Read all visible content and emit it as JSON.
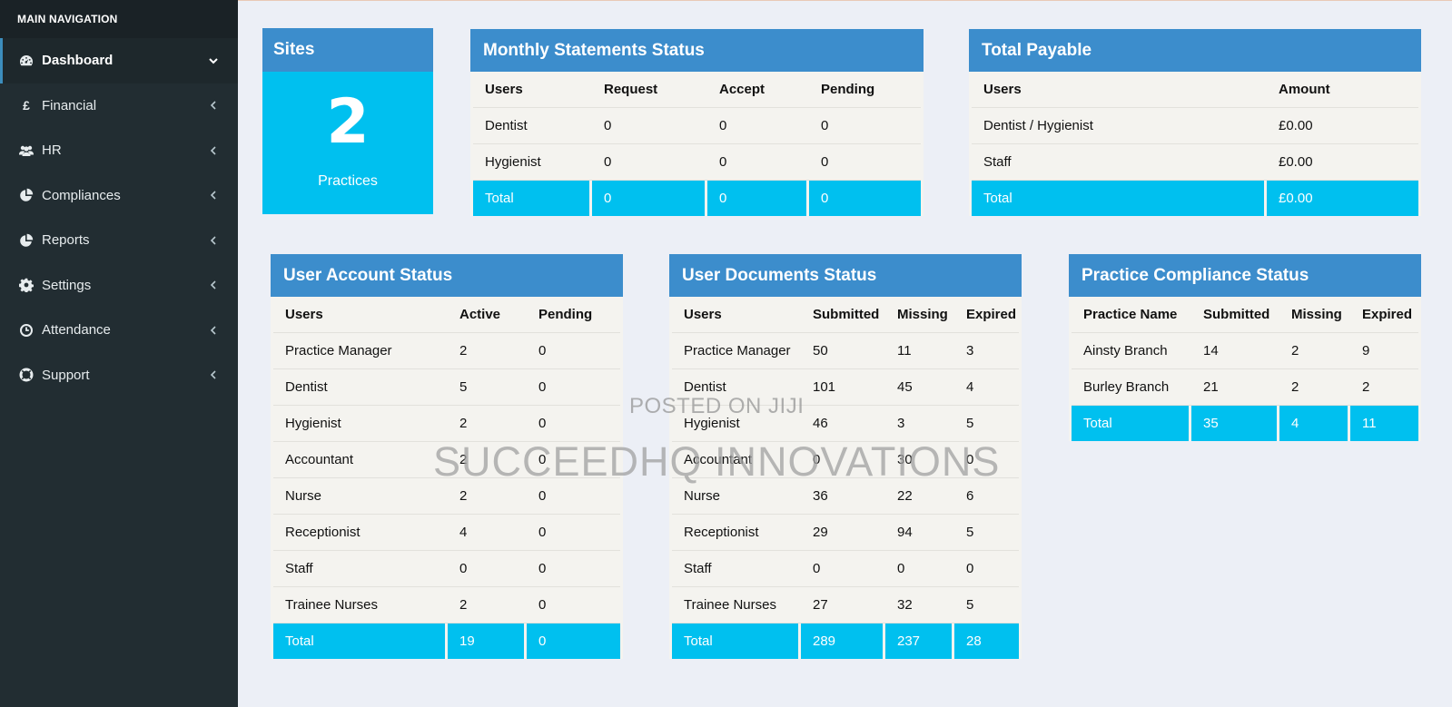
{
  "nav": {
    "header": "MAIN NAVIGATION",
    "items": [
      {
        "label": "Dashboard",
        "icon": "dashboard-icon",
        "active": true
      },
      {
        "label": "Financial",
        "icon": "pound-icon"
      },
      {
        "label": "HR",
        "icon": "users-icon"
      },
      {
        "label": "Compliances",
        "icon": "pie-chart-icon"
      },
      {
        "label": "Reports",
        "icon": "pie-chart-icon"
      },
      {
        "label": "Settings",
        "icon": "gear-icon"
      },
      {
        "label": "Attendance",
        "icon": "clock-icon"
      },
      {
        "label": "Support",
        "icon": "lifebuoy-icon"
      }
    ],
    "pound_glyph": "£"
  },
  "sites": {
    "title": "Sites",
    "count": "2",
    "label": "Practices"
  },
  "monthly": {
    "title": "Monthly Statements Status",
    "headers": [
      "Users",
      "Request",
      "Accept",
      "Pending"
    ],
    "rows": [
      [
        "Dentist",
        "0",
        "0",
        "0"
      ],
      [
        "Hygienist",
        "0",
        "0",
        "0"
      ]
    ],
    "total": [
      "Total",
      "0",
      "0",
      "0"
    ]
  },
  "payable": {
    "title": "Total Payable",
    "headers": [
      "Users",
      "Amount"
    ],
    "rows": [
      [
        "Dentist / Hygienist",
        "£0.00"
      ],
      [
        "Staff",
        "£0.00"
      ]
    ],
    "total": [
      "Total",
      "£0.00"
    ]
  },
  "account": {
    "title": "User Account Status",
    "headers": [
      "Users",
      "Active",
      "Pending"
    ],
    "rows": [
      [
        "Practice Manager",
        "2",
        "0"
      ],
      [
        "Dentist",
        "5",
        "0"
      ],
      [
        "Hygienist",
        "2",
        "0"
      ],
      [
        "Accountant",
        "2",
        "0"
      ],
      [
        "Nurse",
        "2",
        "0"
      ],
      [
        "Receptionist",
        "4",
        "0"
      ],
      [
        "Staff",
        "0",
        "0"
      ],
      [
        "Trainee Nurses",
        "2",
        "0"
      ]
    ],
    "total": [
      "Total",
      "19",
      "0"
    ]
  },
  "documents": {
    "title": "User Documents Status",
    "headers": [
      "Users",
      "Submitted",
      "Missing",
      "Expired"
    ],
    "rows": [
      [
        "Practice Manager",
        "50",
        "11",
        "3"
      ],
      [
        "Dentist",
        "101",
        "45",
        "4"
      ],
      [
        "Hygienist",
        "46",
        "3",
        "5"
      ],
      [
        "Accountant",
        "0",
        "30",
        "0"
      ],
      [
        "Nurse",
        "36",
        "22",
        "6"
      ],
      [
        "Receptionist",
        "29",
        "94",
        "5"
      ],
      [
        "Staff",
        "0",
        "0",
        "0"
      ],
      [
        "Trainee Nurses",
        "27",
        "32",
        "5"
      ]
    ],
    "total": [
      "Total",
      "289",
      "237",
      "28"
    ]
  },
  "compliance": {
    "title": "Practice Compliance Status",
    "headers": [
      "Practice Name",
      "Submitted",
      "Missing",
      "Expired"
    ],
    "rows": [
      [
        "Ainsty Branch",
        "14",
        "2",
        "9"
      ],
      [
        "Burley Branch",
        "21",
        "2",
        "2"
      ]
    ],
    "total": [
      "Total",
      "35",
      "4",
      "11"
    ]
  },
  "watermark": {
    "line1": "POSTED ON JIJI",
    "line2": "SUCCEEDHQ INNOVATIONS"
  },
  "colors": {
    "header_blue": "#3c8dcc",
    "total_cyan": "#00c0ef",
    "sidebar": "#222d32"
  }
}
